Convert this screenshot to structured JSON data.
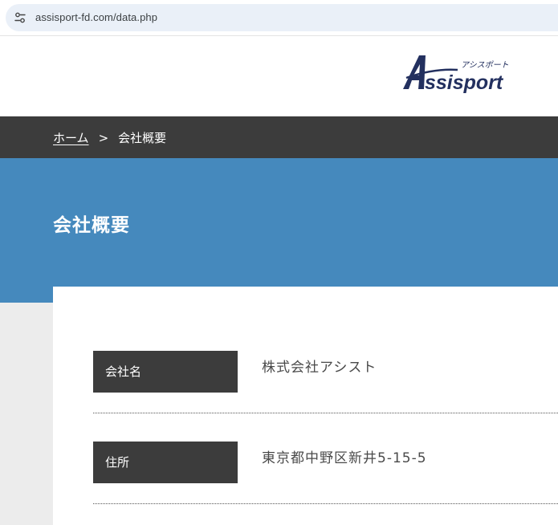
{
  "browser": {
    "url": "assisport-fd.com/data.php",
    "site_info_icon": "tune-icon"
  },
  "header": {
    "logo_text": "Assisport",
    "logo_kana": "アシスポート",
    "logo_color": "#23305f"
  },
  "breadcrumb": {
    "home_label": "ホーム",
    "separator": ">",
    "current_label": "会社概要"
  },
  "hero": {
    "title": "会社概要",
    "color": "#4589bd"
  },
  "company_info": {
    "rows": [
      {
        "label": "会社名",
        "value": "株式会社アシスト"
      },
      {
        "label": "住所",
        "value": "東京都中野区新井5-15-5"
      }
    ]
  }
}
